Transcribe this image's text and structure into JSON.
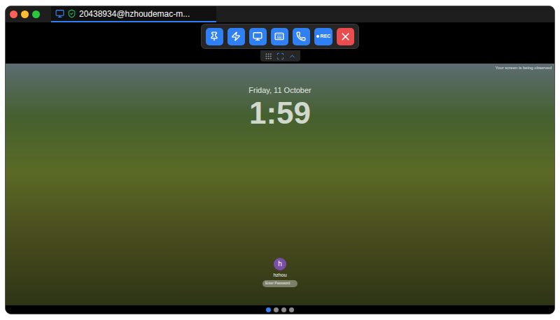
{
  "window": {
    "title": "20438934@hzhoudemac-m..."
  },
  "toolbar": {
    "buttons": [
      {
        "kind": "pin"
      },
      {
        "kind": "action"
      },
      {
        "kind": "display"
      },
      {
        "kind": "keyboard"
      },
      {
        "kind": "call"
      },
      {
        "kind": "record",
        "label": "REC"
      },
      {
        "kind": "close"
      }
    ]
  },
  "handle": {
    "buttons": [
      {
        "kind": "move"
      },
      {
        "kind": "fullscreen"
      },
      {
        "kind": "collapse"
      }
    ]
  },
  "lock_screen": {
    "notice": "Your screen is being observed",
    "date": "Friday, 11 October",
    "time": "1:59",
    "user": {
      "name": "hzhou",
      "initial": "h"
    },
    "password": {
      "placeholder": "Enter Password"
    }
  },
  "pages": [
    {
      "selected": true
    },
    {
      "selected": false
    },
    {
      "selected": false
    },
    {
      "selected": false
    }
  ]
}
